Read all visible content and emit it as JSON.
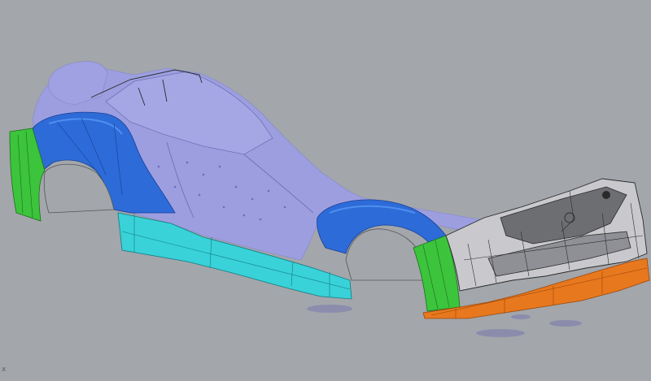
{
  "viewport": {
    "background": "#a3a6ab",
    "axis_label": "x"
  },
  "model": {
    "scan_color": "#9c9ee0",
    "fender_color": "#2d6bd8",
    "fender_tip_color": "#3cc43c",
    "side_skirt_color": "#38d2d8",
    "front_lip_color": "#e8781e",
    "bumper_color": "#c9c9cd",
    "wireframe_color": "#2a2a2a"
  }
}
